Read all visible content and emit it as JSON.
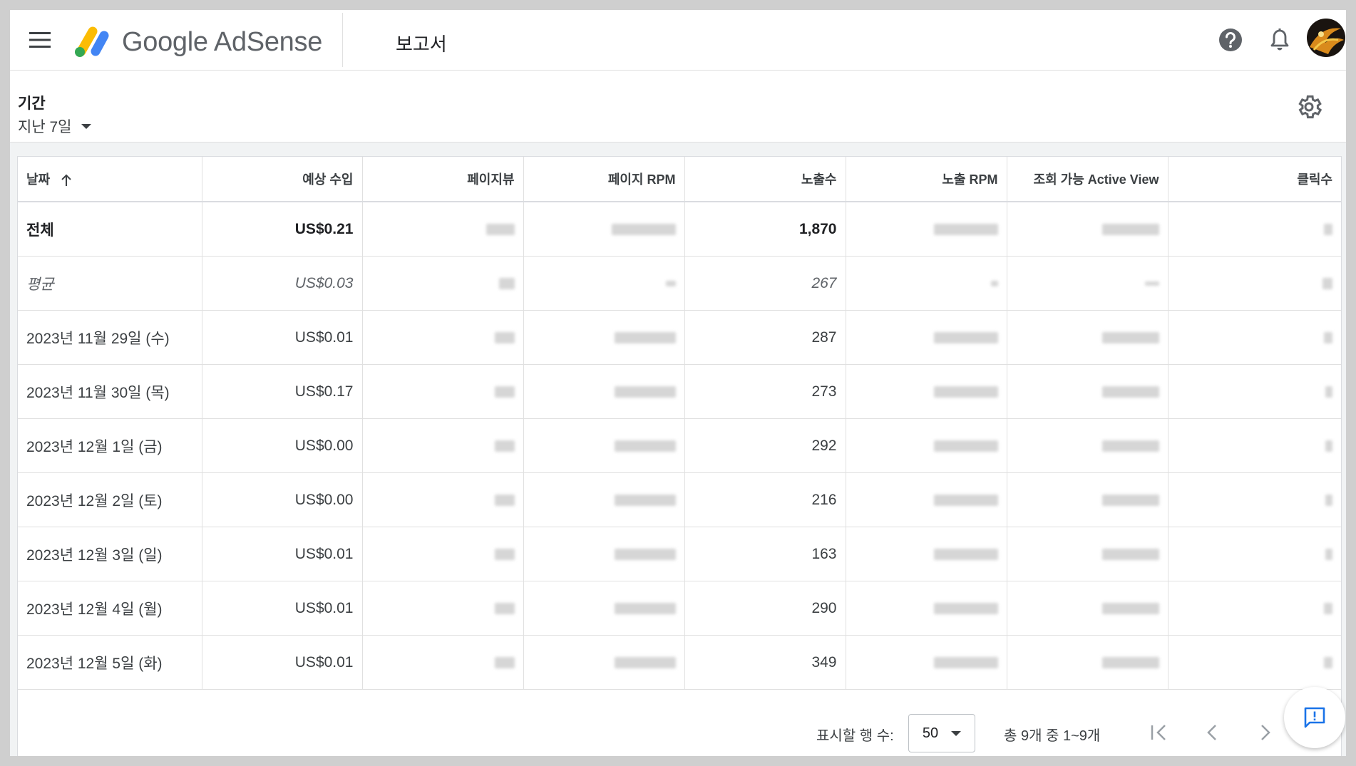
{
  "app": {
    "logo_text": "Google AdSense",
    "page_title": "보고서"
  },
  "filter": {
    "period_label": "기간",
    "period_value": "지난 7일"
  },
  "table": {
    "columns": [
      "날짜",
      "예상 수입",
      "페이지뷰",
      "페이지 RPM",
      "노출수",
      "노출 RPM",
      "조회 가능 Active View",
      "클릭수"
    ],
    "total": {
      "date": "전체",
      "earnings": "US$0.21",
      "impressions": "1,870"
    },
    "average": {
      "date": "평균",
      "earnings": "US$0.03",
      "impressions": "267"
    },
    "rows": [
      {
        "date": "2023년 11월 29일 (수)",
        "earnings": "US$0.01",
        "impressions": "287"
      },
      {
        "date": "2023년 11월 30일 (목)",
        "earnings": "US$0.17",
        "impressions": "273"
      },
      {
        "date": "2023년 12월 1일 (금)",
        "earnings": "US$0.00",
        "impressions": "292"
      },
      {
        "date": "2023년 12월 2일 (토)",
        "earnings": "US$0.00",
        "impressions": "216"
      },
      {
        "date": "2023년 12월 3일 (일)",
        "earnings": "US$0.01",
        "impressions": "163"
      },
      {
        "date": "2023년 12월 4일 (월)",
        "earnings": "US$0.01",
        "impressions": "290"
      },
      {
        "date": "2023년 12월 5일 (화)",
        "earnings": "US$0.01",
        "impressions": "349"
      }
    ]
  },
  "footer": {
    "rows_label": "표시할 행 수:",
    "rows_value": "50",
    "range_text": "총 9개 중 1~9개"
  },
  "colors": {
    "logo_yellow": "#fbbc04",
    "logo_green": "#34a853",
    "logo_blue": "#4285f4",
    "accent": "#1a73e8"
  }
}
